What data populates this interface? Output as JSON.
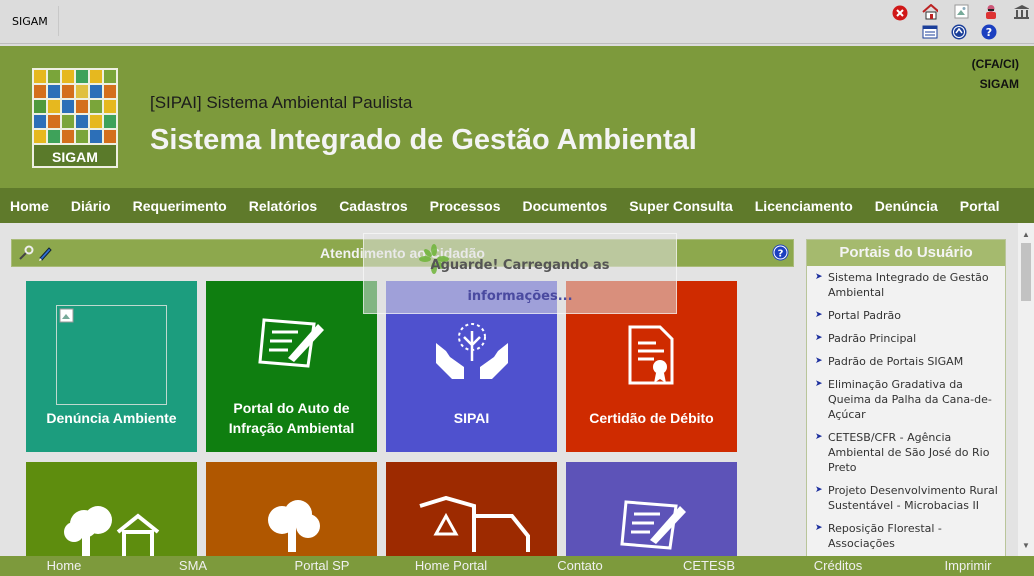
{
  "topbar": {
    "app_name": "SIGAM",
    "icons": [
      "close-icon",
      "home-icon",
      "broken-image-icon",
      "user-icon",
      "institution-icon",
      "window-icon",
      "up-arrow-icon",
      "help-icon"
    ]
  },
  "header": {
    "logo_text": "SIGAM",
    "subtitle": "[SIPAI] Sistema Ambiental Paulista",
    "title": "Sistema Integrado de Gestão Ambiental",
    "right_line1": "(CFA/CI)",
    "right_line2": "SIGAM"
  },
  "nav": {
    "items": [
      "Home",
      "Diário",
      "Requerimento",
      "Relatórios",
      "Cadastros",
      "Processos",
      "Documentos",
      "Super Consulta",
      "Licenciamento",
      "Denúncia",
      "Portal"
    ]
  },
  "section": {
    "title": "Atendimento ao Cidadão"
  },
  "tiles": [
    {
      "label": "Denúncia Ambiente",
      "color": "#1c9d7e"
    },
    {
      "label": "Portal do Auto de Infração Ambiental",
      "color": "#0f7e10"
    },
    {
      "label": "SIPAI",
      "color": "#4f51ce"
    },
    {
      "label": "Certidão de Débito",
      "color": "#cf2b00"
    },
    {
      "label": "",
      "color": "#5e8d0e"
    },
    {
      "label": "",
      "color": "#b05700"
    },
    {
      "label": "",
      "color": "#9d2a00"
    },
    {
      "label": "",
      "color": "#5d53b8"
    }
  ],
  "loading": {
    "line1": "Aguarde! Carregando as",
    "line2": "informações..."
  },
  "sidebar": {
    "title": "Portais do Usuário",
    "items": [
      "Sistema Integrado de Gestão Ambiental",
      "Portal Padrão",
      "Padrão Principal",
      "Padrão de Portais SIGAM",
      "Eliminação Gradativa da Queima da Palha da Cana-de-Açúcar",
      "CETESB/CFR - Agência Ambiental de São José do Rio Preto",
      "Projeto Desenvolvimento Rural Sustentável - Microbacias II",
      "Reposição Florestal - Associações"
    ]
  },
  "footer": {
    "links": [
      "Home",
      "SMA",
      "Portal SP",
      "Home Portal",
      "Contato",
      "CETESB",
      "Créditos",
      "Imprimir"
    ]
  }
}
